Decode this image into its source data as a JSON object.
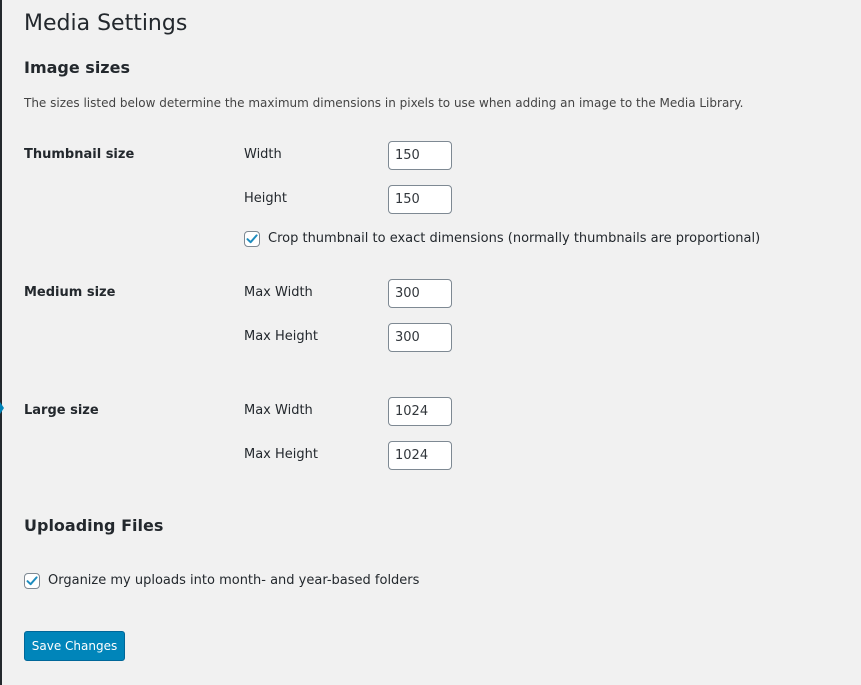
{
  "page": {
    "title": "Media Settings"
  },
  "image_sizes": {
    "heading": "Image sizes",
    "description": "The sizes listed below determine the maximum dimensions in pixels to use when adding an image to the Media Library.",
    "thumbnail": {
      "label": "Thumbnail size",
      "width_label": "Width",
      "width_value": "150",
      "height_label": "Height",
      "height_value": "150",
      "crop_label": "Crop thumbnail to exact dimensions (normally thumbnails are proportional)",
      "crop_checked": true
    },
    "medium": {
      "label": "Medium size",
      "width_label": "Max Width",
      "width_value": "300",
      "height_label": "Max Height",
      "height_value": "300"
    },
    "large": {
      "label": "Large size",
      "width_label": "Max Width",
      "width_value": "1024",
      "height_label": "Max Height",
      "height_value": "1024"
    }
  },
  "uploading": {
    "heading": "Uploading Files",
    "organize_label": "Organize my uploads into month- and year-based folders",
    "organize_checked": true
  },
  "actions": {
    "save_label": "Save Changes"
  },
  "colors": {
    "primary": "#0085ba",
    "background": "#f1f1f1",
    "text": "#23282d"
  }
}
